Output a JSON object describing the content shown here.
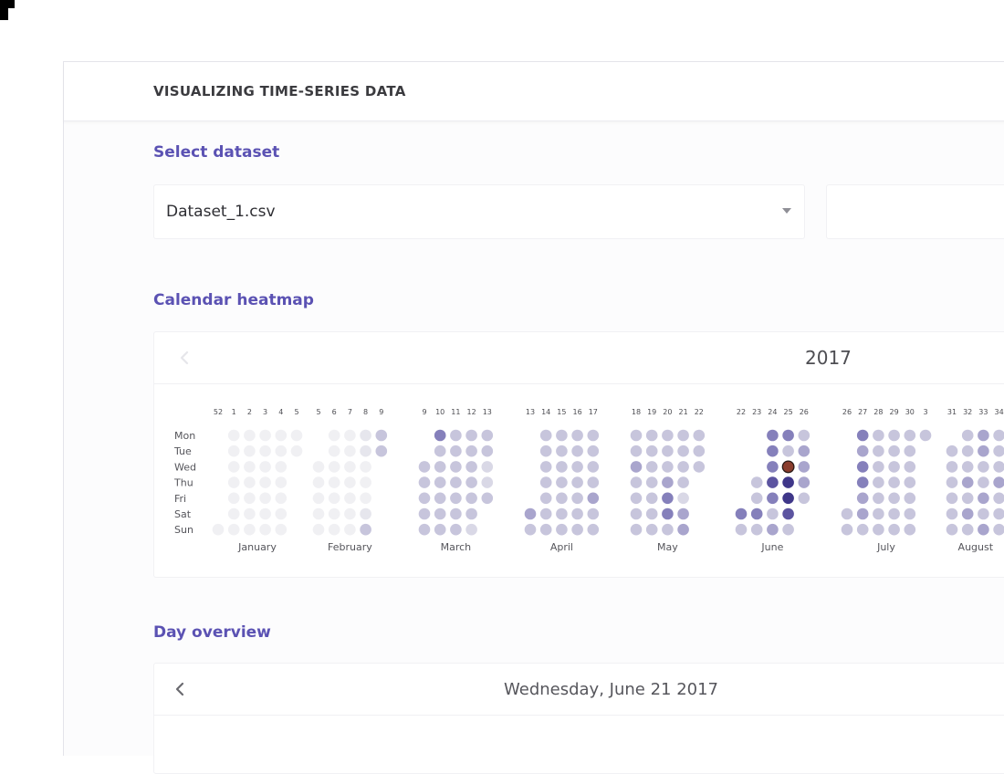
{
  "app": {
    "title": "VISUALIZING TIME-SERIES DATA"
  },
  "dataset": {
    "section_title": "Select dataset",
    "selected": "Dataset_1.csv",
    "options_visible": [
      "Dataset_1.csv"
    ]
  },
  "heatmap": {
    "section_title": "Calendar heatmap",
    "year": "2017",
    "prev_icon": "chevron-left-icon",
    "weekday_labels": [
      "Mon",
      "Tue",
      "Wed",
      "Thu",
      "Fri",
      "Sat",
      "Sun"
    ],
    "months": [
      "January",
      "February",
      "March",
      "April",
      "May",
      "June",
      "July",
      "August"
    ],
    "week_numbers": [
      [
        "52",
        "1",
        "2",
        "3",
        "4",
        "5"
      ],
      [
        "5",
        "6",
        "7",
        "8",
        "9"
      ],
      [
        "9",
        "10",
        "11",
        "12",
        "13"
      ],
      [
        "13",
        "14",
        "15",
        "16",
        "17"
      ],
      [
        "18",
        "19",
        "20",
        "21",
        "22"
      ],
      [
        "22",
        "23",
        "24",
        "25",
        "26"
      ],
      [
        "26",
        "27",
        "28",
        "29",
        "30",
        "3"
      ],
      [
        "31",
        "32",
        "33",
        "34"
      ]
    ],
    "colors": {
      "l0": "#f0f0f3",
      "l1": "#e6e6ed",
      "l2": "#d9d8e6",
      "l3": "#c7c5dc",
      "l4": "#a9a5cd",
      "l5": "#8580bb",
      "l6": "#5c54a0",
      "l7": "#3f3789",
      "selected": "#8a3d2d"
    }
  },
  "chart_data": {
    "type": "heatmap",
    "title": "2017",
    "x_unit": "ISO week",
    "y_categories": [
      "Mon",
      "Tue",
      "Wed",
      "Thu",
      "Fri",
      "Sat",
      "Sun"
    ],
    "intensity_scale": "0 (lightest) to 7 (darkest)",
    "selected_date": "2017-06-21",
    "months": [
      {
        "name": "January",
        "weeks": [
          "52",
          "1",
          "2",
          "3",
          "4",
          "5"
        ],
        "values": [
          [
            null,
            0,
            0,
            0,
            0,
            0
          ],
          [
            null,
            0,
            0,
            0,
            0,
            0
          ],
          [
            null,
            0,
            0,
            0,
            0,
            null
          ],
          [
            null,
            0,
            0,
            0,
            0,
            null
          ],
          [
            null,
            0,
            0,
            0,
            0,
            null
          ],
          [
            null,
            0,
            0,
            0,
            0,
            null
          ],
          [
            0,
            0,
            0,
            0,
            0,
            null
          ]
        ]
      },
      {
        "name": "February",
        "weeks": [
          "5",
          "6",
          "7",
          "8",
          "9"
        ],
        "values": [
          [
            null,
            0,
            0,
            1,
            3
          ],
          [
            null,
            0,
            0,
            1,
            3
          ],
          [
            0,
            0,
            0,
            0,
            null
          ],
          [
            0,
            0,
            0,
            0,
            null
          ],
          [
            0,
            0,
            0,
            0,
            null
          ],
          [
            0,
            0,
            0,
            1,
            null
          ],
          [
            0,
            0,
            0,
            3,
            null
          ]
        ]
      },
      {
        "name": "March",
        "weeks": [
          "9",
          "10",
          "11",
          "12",
          "13"
        ],
        "values": [
          [
            null,
            5,
            3,
            3,
            3
          ],
          [
            null,
            3,
            3,
            3,
            3
          ],
          [
            3,
            3,
            3,
            3,
            2
          ],
          [
            3,
            3,
            3,
            3,
            2
          ],
          [
            3,
            3,
            3,
            3,
            3
          ],
          [
            3,
            3,
            3,
            3,
            null
          ],
          [
            3,
            3,
            3,
            2,
            null
          ]
        ]
      },
      {
        "name": "April",
        "weeks": [
          "13",
          "14",
          "15",
          "16",
          "17"
        ],
        "values": [
          [
            null,
            3,
            3,
            3,
            3
          ],
          [
            null,
            3,
            3,
            3,
            3
          ],
          [
            null,
            3,
            3,
            3,
            3
          ],
          [
            null,
            3,
            3,
            3,
            3
          ],
          [
            null,
            3,
            3,
            3,
            4
          ],
          [
            4,
            3,
            3,
            3,
            3
          ],
          [
            3,
            3,
            3,
            3,
            3
          ]
        ]
      },
      {
        "name": "May",
        "weeks": [
          "18",
          "19",
          "20",
          "21",
          "22"
        ],
        "values": [
          [
            3,
            3,
            3,
            3,
            3
          ],
          [
            3,
            3,
            3,
            3,
            3
          ],
          [
            4,
            3,
            3,
            3,
            3
          ],
          [
            3,
            3,
            4,
            3,
            null
          ],
          [
            3,
            3,
            5,
            2,
            null
          ],
          [
            3,
            3,
            5,
            4,
            null
          ],
          [
            3,
            3,
            3,
            4,
            null
          ]
        ]
      },
      {
        "name": "June",
        "weeks": [
          "22",
          "23",
          "24",
          "25",
          "26"
        ],
        "values": [
          [
            null,
            null,
            5,
            5,
            3
          ],
          [
            null,
            null,
            5,
            3,
            4
          ],
          [
            null,
            null,
            5,
            8,
            4
          ],
          [
            null,
            3,
            6,
            7,
            4
          ],
          [
            null,
            3,
            5,
            7,
            3
          ],
          [
            5,
            5,
            3,
            6,
            null
          ],
          [
            3,
            3,
            4,
            3,
            null
          ]
        ]
      },
      {
        "name": "July",
        "weeks": [
          "26",
          "27",
          "28",
          "29",
          "30",
          "3"
        ],
        "values": [
          [
            null,
            5,
            3,
            3,
            3,
            3
          ],
          [
            null,
            4,
            3,
            3,
            3,
            null
          ],
          [
            null,
            5,
            3,
            3,
            3,
            null
          ],
          [
            null,
            5,
            3,
            3,
            3,
            null
          ],
          [
            null,
            4,
            3,
            3,
            3,
            null
          ],
          [
            3,
            4,
            3,
            3,
            3,
            null
          ],
          [
            3,
            3,
            3,
            3,
            3,
            null
          ]
        ]
      },
      {
        "name": "August",
        "weeks": [
          "31",
          "32",
          "33",
          "34"
        ],
        "values": [
          [
            null,
            3,
            4,
            3
          ],
          [
            3,
            3,
            4,
            3
          ],
          [
            3,
            3,
            3,
            3
          ],
          [
            3,
            4,
            3,
            4
          ],
          [
            3,
            3,
            4,
            3
          ],
          [
            3,
            4,
            3,
            3
          ],
          [
            3,
            3,
            4,
            3
          ]
        ]
      }
    ]
  },
  "day_overview": {
    "section_title": "Day overview",
    "date_label": "Wednesday, June 21 2017",
    "prev_icon": "chevron-left-icon"
  }
}
